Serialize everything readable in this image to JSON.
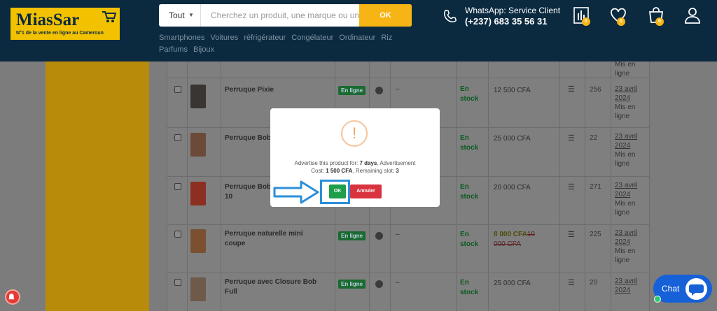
{
  "header": {
    "logo": {
      "title": "MiasSar",
      "tagline": "N°1 de la vente en ligne au Cameroun"
    },
    "search": {
      "category": "Tout",
      "placeholder": "Cherchez un produit, une marque ou un",
      "button": "OK"
    },
    "quick_links": [
      "Smartphones",
      "Voitures",
      "réfrigérateur",
      "Congélateur",
      "Ordinateur",
      "Riz",
      "Parfums",
      "Bijoux"
    ],
    "contact": {
      "title": "WhatsApp: Service Client",
      "number": "(+237) 683 35 56 31"
    },
    "badges": {
      "compare": "0",
      "wishlist": "0",
      "cart": "0"
    }
  },
  "table": {
    "top_row_tail": {
      "date_tail": [
        "Mis en",
        "ligne"
      ]
    },
    "rows": [
      {
        "name": "Perruque Pixie",
        "status": "En ligne",
        "dash": "–",
        "stock": [
          "En",
          "stock"
        ],
        "price": "12 500 CFA",
        "count": "256",
        "date": [
          "23 avril",
          "2024"
        ],
        "state": [
          "Mis en",
          "ligne"
        ]
      },
      {
        "name": "Perruque Bob",
        "status": "",
        "dash": "",
        "stock": [
          "En",
          "stock"
        ],
        "price": "25 000 CFA",
        "count": "22",
        "date": [
          "23 avril",
          "2024"
        ],
        "state": [
          "Mis en",
          "ligne"
        ]
      },
      {
        "name": "Perruque Bob",
        "name2": "10",
        "status": "",
        "dash": "",
        "stock": [
          "En",
          "stock"
        ],
        "price": "20 000 CFA",
        "count": "271",
        "date": [
          "23 avril",
          "2024"
        ],
        "state": [
          "Mis en",
          "ligne"
        ]
      },
      {
        "name": "Perruque naturelle mini",
        "name2": "coupe",
        "status": "En ligne",
        "dash": "–",
        "stock": [
          "En",
          "stock"
        ],
        "price_sale": "8 000 CFA",
        "price_old1": "10",
        "price_old2": "000 CFA",
        "count": "225",
        "date": [
          "23 avril",
          "2024"
        ],
        "state": [
          "Mis en",
          "ligne"
        ]
      },
      {
        "name": "Perruque avec Closure Bob",
        "name2": "Full",
        "status": "En ligne",
        "dash": "–",
        "stock": [
          "En",
          "stock"
        ],
        "price": "25 000 CFA",
        "count": "20",
        "date": [
          "23 avril",
          "2024"
        ],
        "state": []
      }
    ]
  },
  "modal": {
    "line1_prefix": "Advertise this product for: ",
    "days": "7 days",
    "line1_suffix": ", Advertisement",
    "cost_prefix": "Cost: ",
    "cost": "1 500 CFA",
    "slots_prefix": ", Remaining slot: ",
    "slots": "3",
    "ok": "OK",
    "cancel": "Annuler"
  },
  "chat": {
    "label": "Chat"
  },
  "colors": {
    "header": "#0b2a40",
    "accent": "#f7b515",
    "ok": "#1e9e4a",
    "cancel": "#d9333f",
    "highlight": "#2b8fd8"
  }
}
